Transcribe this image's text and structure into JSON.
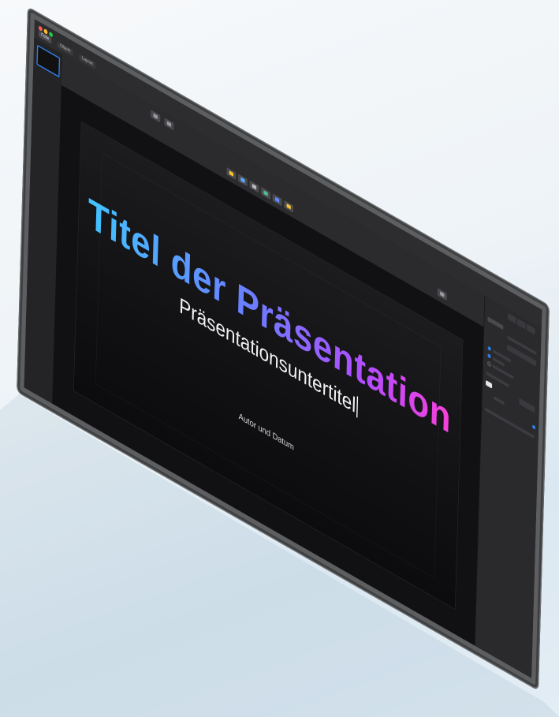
{
  "window": {
    "tabs": [
      "Folie",
      "Objekt",
      "Layout"
    ]
  },
  "slide": {
    "title": "Titel der Präsentation",
    "subtitle": "Präsentationsuntertitel",
    "author_line": "Autor und Datum"
  },
  "colors": {
    "accent": "#2f7fe8",
    "title_gradient_start": "#3fc7ff",
    "title_gradient_end": "#ff3fd5",
    "traffic_red": "#ff5f57",
    "traffic_yellow": "#febc2e",
    "traffic_green": "#28c840"
  },
  "icons": {
    "toolbar": [
      "play-icon",
      "view-icon",
      "table-icon",
      "chart-icon",
      "text-icon",
      "shape-icon",
      "media-icon",
      "comment-icon"
    ],
    "inspector": [
      "format-icon",
      "animate-icon",
      "document-icon"
    ]
  }
}
